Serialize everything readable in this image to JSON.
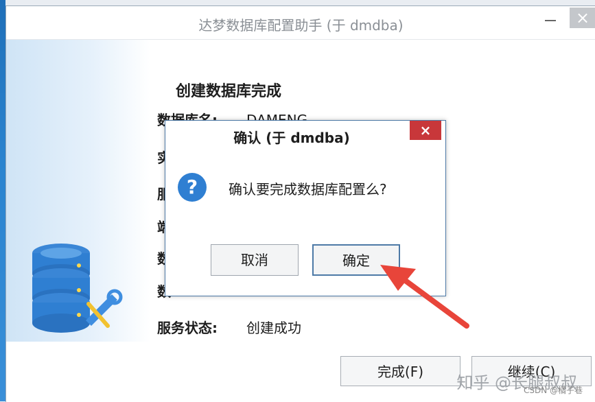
{
  "window": {
    "title": "达梦数据库配置助手 (于 dmdba)",
    "minimize_glyph": "",
    "close_glyph": "×"
  },
  "main": {
    "heading": "创建数据库完成",
    "rows": [
      {
        "label": "数据库名:",
        "value": "DAMENG"
      },
      {
        "label": "实",
        "value": ""
      },
      {
        "label": "服",
        "value": ""
      },
      {
        "label": "端",
        "value": ""
      },
      {
        "label": "数",
        "value": ""
      },
      {
        "label": "数",
        "value": ""
      },
      {
        "label": "服务状态:",
        "value": "创建成功"
      }
    ],
    "finish_button": "完成(F)",
    "continue_button": "继续(C)"
  },
  "dialog": {
    "title": "确认  (于 dmdba)",
    "close_glyph": "×",
    "icon": "question-icon",
    "icon_glyph": "?",
    "message": "确认要完成数据库配置么?",
    "cancel_button": "取消",
    "ok_button": "确定"
  },
  "watermark": {
    "main": "知乎 @长腿叔叔",
    "sub": "CSDN @橘子巷"
  },
  "colors": {
    "dialog_close_bg": "#c8373a",
    "question_icon": "#2f7fd2",
    "arrow": "#e8453a"
  }
}
